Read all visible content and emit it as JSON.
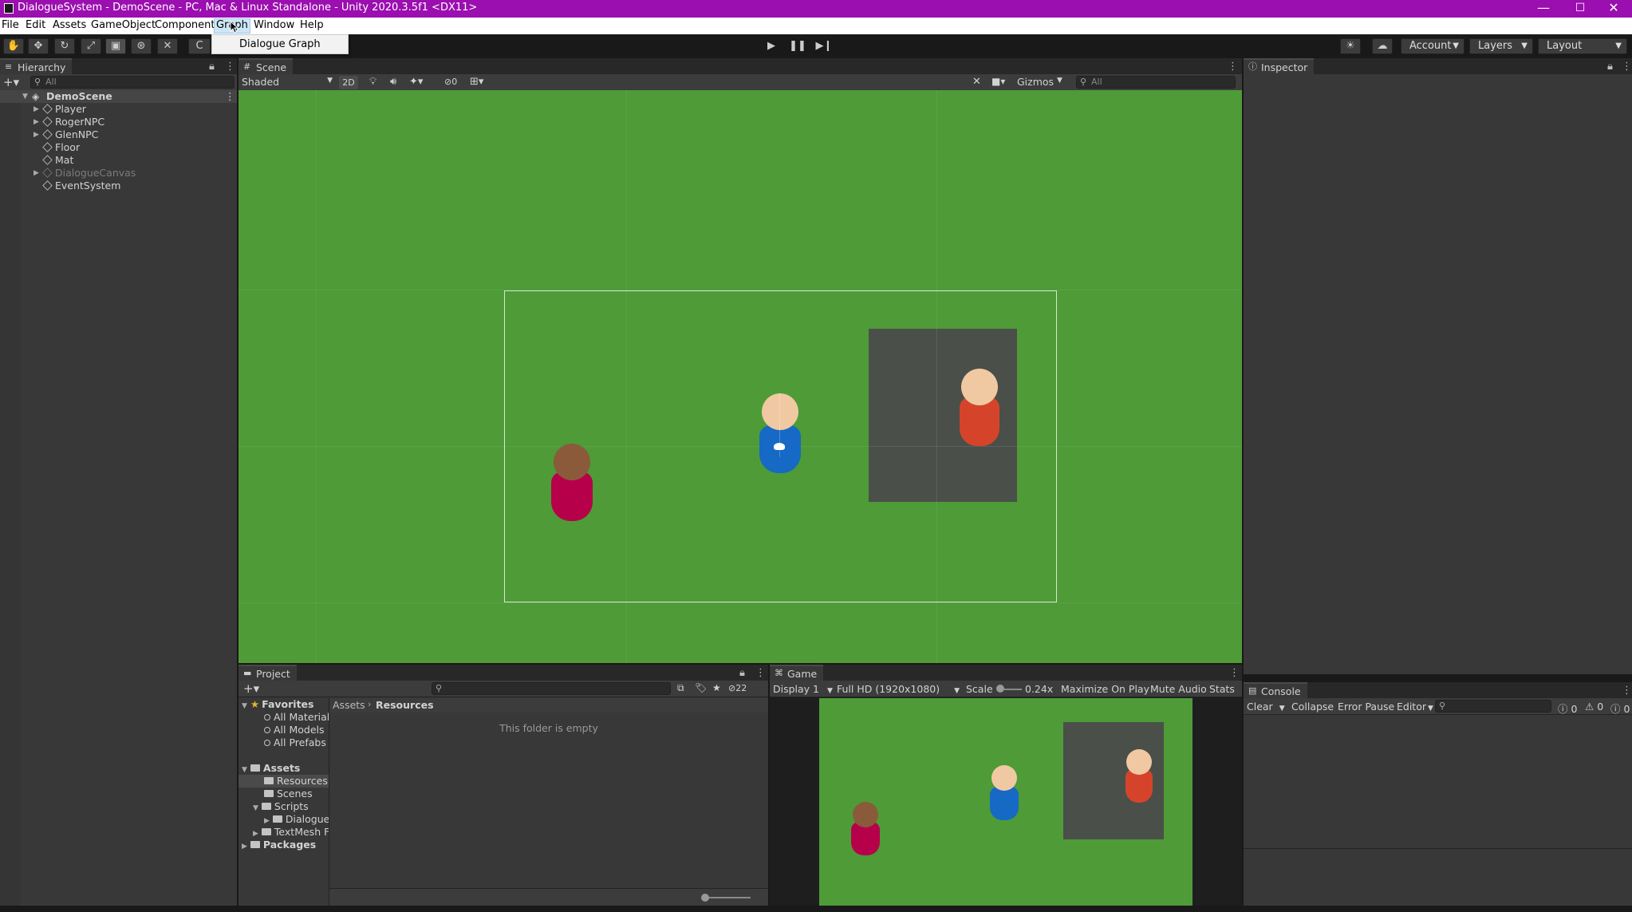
{
  "window": {
    "title": "DialogueSystem - DemoScene - PC, Mac & Linux Standalone - Unity 2020.3.5f1 <DX11>",
    "minimize": "—",
    "maximize": "☐",
    "close": "✕"
  },
  "menu": {
    "items": [
      "File",
      "Edit",
      "Assets",
      "GameObject",
      "Component",
      "Graph",
      "Window",
      "Help"
    ],
    "open_menu_item": "Dialogue Graph"
  },
  "toolbar": {
    "account": "Account",
    "layers": "Layers",
    "layout": "Layout",
    "tool_letter": "C"
  },
  "hierarchy": {
    "tab": "Hierarchy",
    "search_placeholder": "All",
    "scene": "DemoScene",
    "items": [
      "Player",
      "RogerNPC",
      "GlenNPC",
      "Floor",
      "Mat",
      "DialogueCanvas",
      "EventSystem"
    ]
  },
  "scene": {
    "tab": "Scene",
    "shading": "Shaded",
    "mode_2d": "2D",
    "hidden_count": "0",
    "gizmos": "Gizmos",
    "search_placeholder": "All"
  },
  "inspector": {
    "tab": "Inspector"
  },
  "project": {
    "tab": "Project",
    "count": "22",
    "favorites": "Favorites",
    "favorite_items": [
      "All Material",
      "All Models",
      "All Prefabs"
    ],
    "assets": "Assets",
    "asset_items": [
      "Resources",
      "Scenes",
      "Scripts"
    ],
    "script_items": [
      "Dialogue"
    ],
    "textmesh": "TextMesh F",
    "packages": "Packages",
    "breadcrumb_root": "Assets",
    "breadcrumb_current": "Resources",
    "empty_msg": "This folder is empty"
  },
  "game": {
    "tab": "Game",
    "display": "Display 1",
    "resolution": "Full HD (1920x1080)",
    "scale_label": "Scale",
    "scale_value": "0.24x",
    "maximize": "Maximize On Play",
    "mute": "Mute Audio",
    "stats": "Stats"
  },
  "console": {
    "tab": "Console",
    "clear": "Clear",
    "collapse": "Collapse",
    "error_pause": "Error Pause",
    "editor": "Editor",
    "count_info": "0",
    "count_warn": "0",
    "count_err": "0"
  },
  "colors": {
    "title_bar": "#9b0eaf",
    "scene_green": "#4e9b38",
    "npc_red": "#d5442a",
    "npc_crimson": "#b7004a",
    "player_blue": "#1669c5",
    "skin": "#f0c9a2",
    "brown_head": "#8a5a3b",
    "mat_gray": "#4a4f49"
  }
}
